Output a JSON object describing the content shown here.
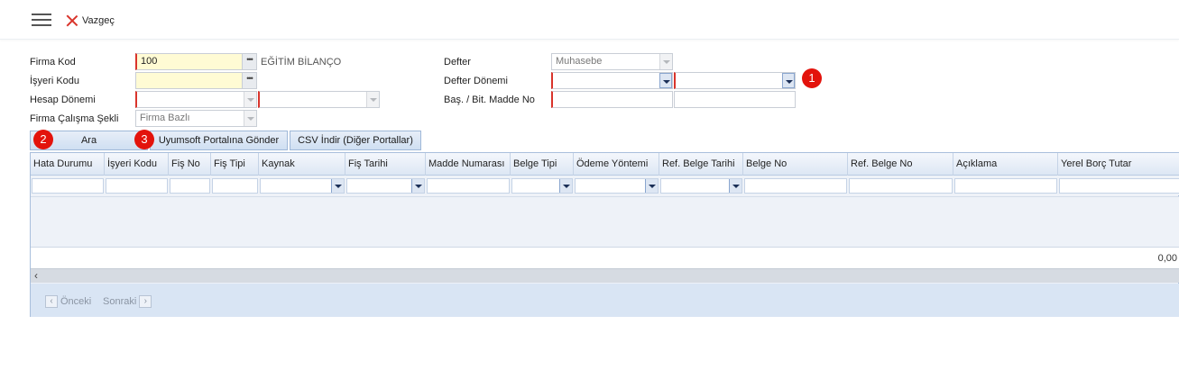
{
  "toolbar": {
    "cancel_label": "Vazgeç"
  },
  "form": {
    "firma_kod_label": "Firma Kod",
    "firma_kod_value": "100",
    "firma_name": "EĞİTİM BİLANÇO",
    "isyeri_kodu_label": "İşyeri Kodu",
    "isyeri_kodu_value": "",
    "hesap_donemi_label": "Hesap Dönemi",
    "calisma_sekli_label": "Firma Çalışma Şekli",
    "calisma_sekli_value": "Firma Bazlı",
    "defter_label": "Defter",
    "defter_value": "Muhasebe",
    "defter_donemi_label": "Defter Dönemi",
    "bas_bit_label": "Baş. / Bit. Madde No"
  },
  "badges": [
    "1",
    "2",
    "3"
  ],
  "buttons": {
    "ara": "Ara",
    "uyumsoft": "Uyumsoft Portalına Gönder",
    "csv": "CSV İndir (Diğer Portallar)"
  },
  "grid": {
    "columns": [
      "Hata Durumu",
      "İşyeri Kodu",
      "Fiş No",
      "Fiş Tipi",
      "Kaynak",
      "Fiş Tarihi",
      "Madde Numarası",
      "Belge Tipi",
      "Ödeme Yöntemi",
      "Ref. Belge Tarihi",
      "Belge No",
      "Ref. Belge No",
      "Açıklama",
      "Yerel Borç Tutar"
    ],
    "footer_total": "0,00",
    "pager_prev": "Önceki",
    "pager_next": "Sonraki"
  },
  "colors": {
    "required": "#d9342b",
    "badge": "#e3130c",
    "highlight_input": "#fffbd4"
  }
}
